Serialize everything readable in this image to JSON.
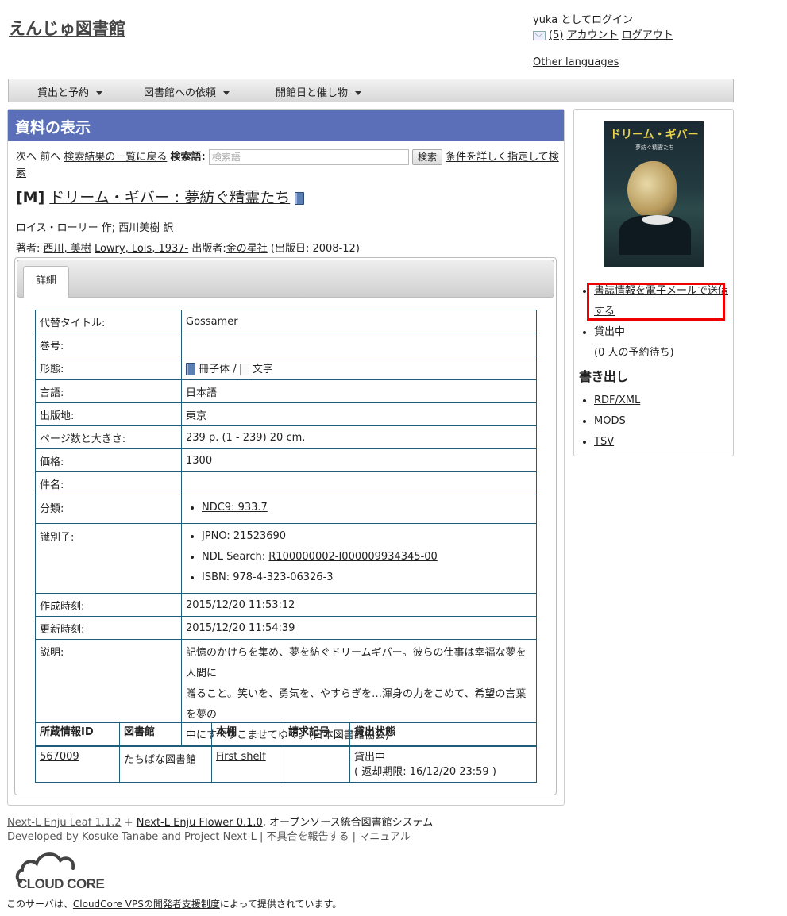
{
  "site": {
    "title": "えんじゅ図書館"
  },
  "user": {
    "login_text": "yuka としてログイン",
    "mail_count": "(5)",
    "account_link": "アカウント",
    "logout_link": "ログアウト",
    "other_languages": "Other languages"
  },
  "menu": [
    {
      "label": "貸出と予約"
    },
    {
      "label": "図書館への依頼"
    },
    {
      "label": "開館日と催し物"
    }
  ],
  "main": {
    "header": "資料の表示",
    "nav": {
      "next": "次へ",
      "prev": "前へ",
      "back_to_results": "検索結果の一覧に戻る",
      "search_label": "検索語:",
      "search_placeholder": "検索語",
      "search_button": "検索",
      "advanced_1": "条件を詳しく指定して検",
      "advanced_2": "索"
    },
    "record": {
      "format_badge": "[M]",
      "title": "ドリーム・ギバー : 夢紡ぐ精霊たち",
      "responsibility": "ロイス・ローリー 作; 西川美樹 訳",
      "authors_label": "著者:",
      "author_1": "西川, 美樹",
      "author_2": "Lowry, Lois, 1937-",
      "publisher_label": "出版者:",
      "publisher": "金の星社",
      "pubdate": "(出版日: 2008-12)"
    },
    "tabs": {
      "detail": "詳細"
    },
    "details": {
      "alt_title_k": "代替タイトル:",
      "alt_title_v": "Gossamer",
      "volume_k": "巻号:",
      "volume_v": "",
      "form_k": "形態:",
      "form_carrier": "冊子体",
      "form_sep": "/",
      "form_content": "文字",
      "lang_k": "言語:",
      "lang_v": "日本語",
      "place_k": "出版地:",
      "place_v": "東京",
      "extent_k": "ページ数と大きさ:",
      "extent_v": "239 p. (1 - 239) 20 cm.",
      "price_k": "価格:",
      "price_v": "1300",
      "subject_k": "件名:",
      "subject_v": "",
      "class_k": "分類:",
      "class_v": "NDC9: 933.7",
      "ident_k": "識別子:",
      "jpno": "JPNO: 21523690",
      "ndl_label": "NDL Search:",
      "ndl_v": "R100000002-I000009934345-00",
      "isbn": "ISBN: 978-4-323-06326-3",
      "created_k": "作成時刻:",
      "created_v": "2015/12/20 11:53:12",
      "updated_k": "更新時刻:",
      "updated_v": "2015/12/20 11:54:39",
      "desc_k": "説明:",
      "desc_1": "記憶のかけらを集め、夢を紡ぐドリームギバー。彼らの仕事は幸福な夢を人間に",
      "desc_2": "贈ること。笑いを、勇気を、やすらぎを…渾身の力をこめて、希望の言葉を夢の",
      "desc_3": "中にすべりこませてゆく。(日本図書館協会)"
    },
    "holdings": {
      "headers": [
        "所蔵情報ID",
        "図書館",
        "本棚",
        "請求記号",
        "貸出状態"
      ],
      "row": {
        "id": "567009",
        "library": "たちばな図書館",
        "shelf": "First shelf",
        "call_number": "",
        "status": "貸出中",
        "due": "( 返却期限: 16/12/20 23:59 )"
      }
    }
  },
  "sidebar": {
    "cover": {
      "title": "ドリーム・ギバー",
      "subtitle": "夢紡ぐ精霊たち",
      "authors": "ロイス・ローリー 作\n西川美樹 訳"
    },
    "email_link_1": "書誌情報を電子メールで送信",
    "email_link_2": "する",
    "status": "貸出中",
    "reservations": "(0 人の予約待ち)",
    "export_heading": "書き出し",
    "exports": [
      "RDF/XML",
      "MODS",
      "TSV"
    ],
    "highlight_color": "#ee0000"
  },
  "footer": {
    "leaf": "Next-L Enju Leaf 1.1.2",
    "plus": "+",
    "flower": "Next-L Enju Flower 0.1.0",
    "tagline": ", オープンソース統合図書館システム",
    "dev_by": "Developed by",
    "dev_name": "Kosuke Tanabe",
    "and": "and",
    "project": "Project Next-L",
    "sep": "|",
    "report": "不具合を報告する",
    "manual": "マニュアル",
    "logo_text": "CLOUD CORE",
    "provided_1": "このサーバは、",
    "provided_link": "CloudCore VPSの開発者支援制度",
    "provided_2": "によって提供されています。"
  }
}
